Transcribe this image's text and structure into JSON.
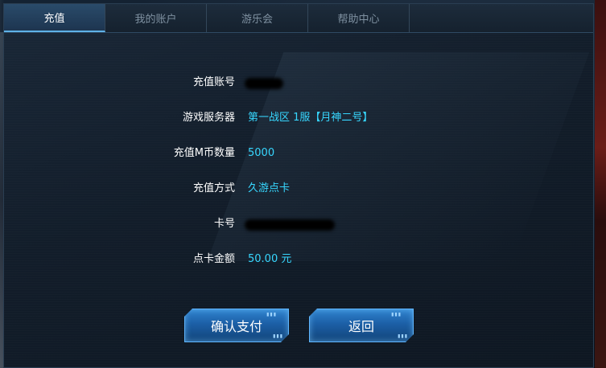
{
  "tabs": [
    {
      "label": "充值",
      "active": true
    },
    {
      "label": "我的账户",
      "active": false
    },
    {
      "label": "游乐会",
      "active": false
    },
    {
      "label": "帮助中心",
      "active": false
    }
  ],
  "form": {
    "account_label": "充值账号",
    "server_label": "游戏服务器",
    "server_value": "第一战区 1服【月神二号】",
    "amount_label": "充值M币数量",
    "amount_value": "5000",
    "method_label": "充值方式",
    "method_value": "久游点卡",
    "card_label": "卡号",
    "card_amount_label": "点卡金额",
    "card_amount_value": "50.00 元"
  },
  "buttons": {
    "confirm_label": "确认支付",
    "back_label": "返回"
  },
  "colors": {
    "value_text": "#37d7ff",
    "active_tab": "#2a4b6a",
    "button": "#1c5fa6"
  }
}
